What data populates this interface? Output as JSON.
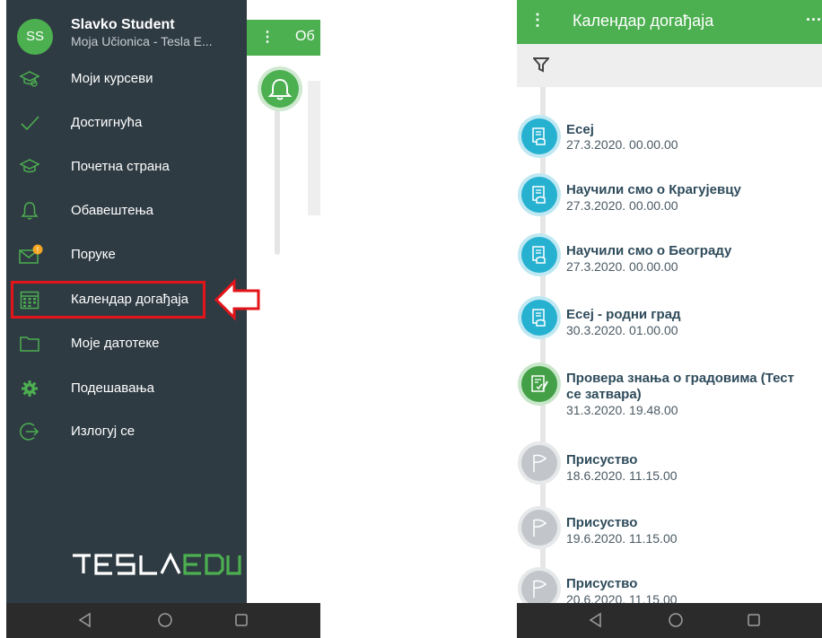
{
  "left": {
    "drawer": {
      "avatar_initials": "SS",
      "user_name": "Slavko Student",
      "user_org": "Moja Učionica - Tesla E...",
      "menu_items": [
        {
          "label": "Моји курсеви",
          "icon": "graduation-cap-icon"
        },
        {
          "label": "Достигнућа",
          "icon": "checkmark-icon"
        },
        {
          "label": "Почетна страна",
          "icon": "graduation-cap-icon"
        },
        {
          "label": "Обавештења",
          "icon": "bell-icon"
        },
        {
          "label": "Поруке",
          "icon": "envelope-icon",
          "badge": "!"
        },
        {
          "label": "Календар догађаја",
          "icon": "calendar-icon",
          "highlighted": true
        },
        {
          "label": "Моје датотеке",
          "icon": "folder-icon"
        },
        {
          "label": "Подешавања",
          "icon": "gear-icon"
        },
        {
          "label": "Излогуј се",
          "icon": "logout-icon"
        }
      ],
      "logo_text": "TESLAEDU"
    },
    "behind_title": "Об"
  },
  "right": {
    "app_title": "Календар догађаја",
    "events": [
      {
        "title": "Есеј",
        "date": "27.3.2020. 00.00.00",
        "type": "assignment",
        "color": "blue"
      },
      {
        "title": "Научили смо о Крагујевцу",
        "date": "27.3.2020. 00.00.00",
        "type": "assignment",
        "color": "blue"
      },
      {
        "title": "Научили смо о Београду",
        "date": "27.3.2020. 00.00.00",
        "type": "assignment",
        "color": "blue"
      },
      {
        "title": "Есеј - родни град",
        "date": "30.3.2020. 01.00.00",
        "type": "assignment",
        "color": "blue"
      },
      {
        "title": "Провера знања о градовима (Тест",
        "title2": "се затвара)",
        "date": "31.3.2020. 19.48.00",
        "type": "quiz",
        "color": "green"
      },
      {
        "title": "Присуство",
        "date": "18.6.2020. 11.15.00",
        "type": "attendance",
        "color": "grey"
      },
      {
        "title": "Присуство",
        "date": "19.6.2020. 11.15.00",
        "type": "attendance",
        "color": "grey"
      },
      {
        "title": "Присуство",
        "date": "20.6.2020. 11.15.00",
        "type": "attendance",
        "color": "grey"
      }
    ]
  },
  "colors": {
    "accent_green": "#4caf50",
    "drawer_bg": "#2f3b43",
    "highlight_red": "#e3151a",
    "assignment_blue": "#26b1d1"
  }
}
